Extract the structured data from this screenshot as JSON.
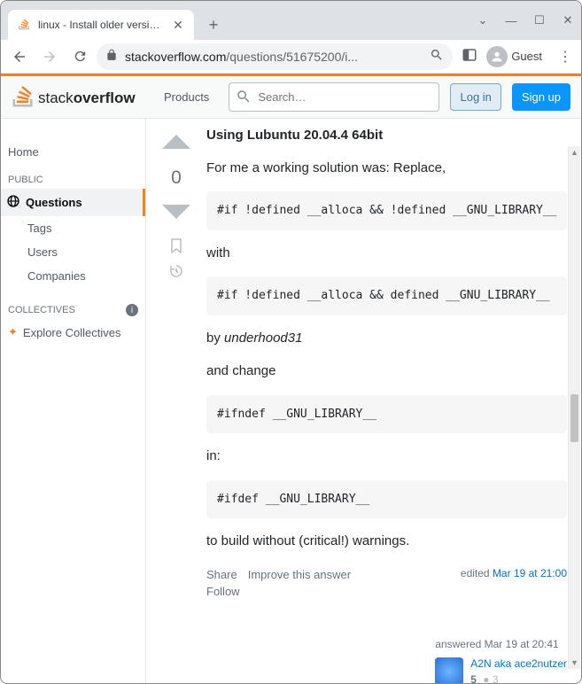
{
  "browser": {
    "tab_title": "linux - Install older version of",
    "url_domain": "stackoverflow.com",
    "url_path": "/questions/51675200/i...",
    "guest_label": "Guest"
  },
  "header": {
    "products": "Products",
    "search_placeholder": "Search…",
    "login": "Log in",
    "signup": "Sign up"
  },
  "sidebar": {
    "home": "Home",
    "public_heading": "PUBLIC",
    "questions": "Questions",
    "tags": "Tags",
    "users": "Users",
    "companies": "Companies",
    "collectives_heading": "COLLECTIVES",
    "explore": "Explore Collectives"
  },
  "answer": {
    "vote_score": "0",
    "title": "Using Lubuntu 20.04.4 64bit",
    "line1": "For me a working solution was: Replace,",
    "code1": "#if !defined __alloca && !defined __GNU_LIBRARY__",
    "line_with": "with",
    "code2": "#if !defined __alloca && defined __GNU_LIBRARY__",
    "line_by_prefix": "by ",
    "line_by_author": "underhood31",
    "line_and_change": "and change",
    "code3": "#ifndef __GNU_LIBRARY__",
    "line_in": "in:",
    "code4": "#ifdef __GNU_LIBRARY__",
    "line_end": "to build without (critical!) warnings.",
    "actions": {
      "share": "Share",
      "improve": "Improve this answer",
      "follow": "Follow"
    },
    "edited_label": "edited ",
    "edited_time": "Mar 19 at 21:00",
    "answered_label": "answered ",
    "answered_time": "Mar 19 at 20:41",
    "user_name": "A2N aka ace2nutzer",
    "user_rep": "5",
    "user_bronze": "3"
  }
}
